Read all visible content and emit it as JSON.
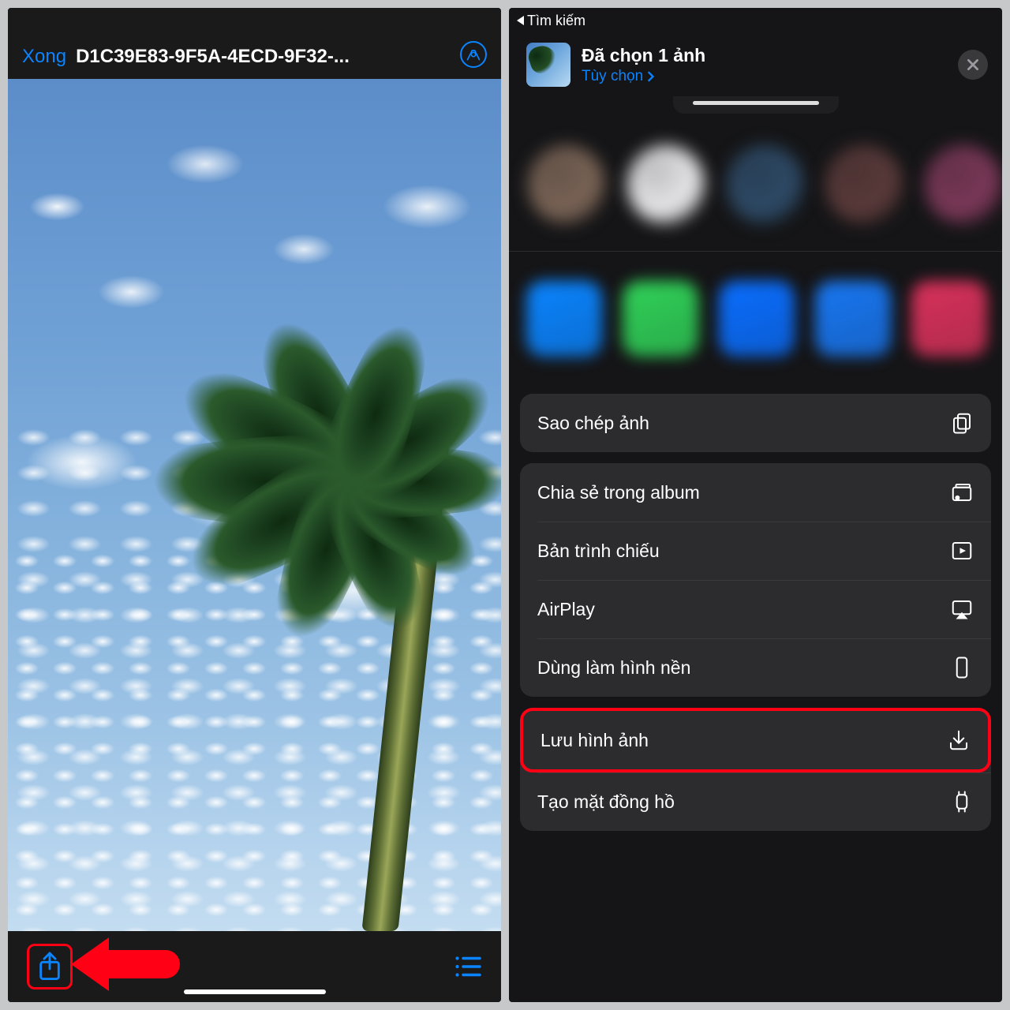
{
  "left": {
    "header": {
      "done": "Xong",
      "title": "D1C39E83-9F5A-4ECD-9F32-..."
    },
    "footer": {
      "share_label": "Share",
      "list_label": "List"
    }
  },
  "right": {
    "status_back": "Tìm kiếm",
    "share_header": {
      "title": "Đã chọn 1 ảnh",
      "options": "Tùy chọn"
    },
    "contact_colors": [
      "#7a6456",
      "#e8e8ea",
      "#2e4a66",
      "#5a3a3a",
      "#7a3858"
    ],
    "app_colors": [
      "#0a84ff",
      "#30d158",
      "#0a6eff",
      "#1877f2",
      "#d8315b"
    ],
    "group1": [
      {
        "key": "copy",
        "label": "Sao chép ảnh",
        "icon": "copy"
      }
    ],
    "group2": [
      {
        "key": "album",
        "label": "Chia sẻ trong album",
        "icon": "album"
      },
      {
        "key": "slideshow",
        "label": "Bản trình chiếu",
        "icon": "play"
      },
      {
        "key": "airplay",
        "label": "AirPlay",
        "icon": "airplay"
      },
      {
        "key": "wallpaper",
        "label": "Dùng làm hình nền",
        "icon": "phone"
      }
    ],
    "group3": [
      {
        "key": "save",
        "label": "Lưu hình ảnh",
        "icon": "download",
        "hot": true
      },
      {
        "key": "watch",
        "label": "Tạo mặt đồng hồ",
        "icon": "watch"
      }
    ]
  }
}
